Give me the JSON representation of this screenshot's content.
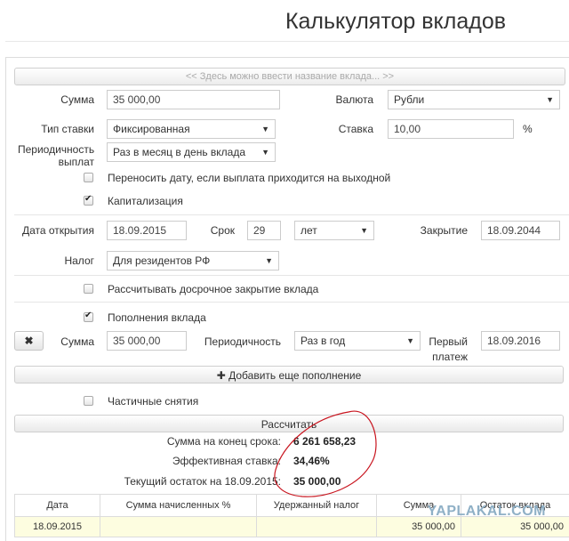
{
  "page_title": "Калькулятор вкладов",
  "deposit_name_placeholder": "<< Здесь можно ввести название вклада... >>",
  "form": {
    "amount_label": "Сумма",
    "amount_value": "35 000,00",
    "currency_label": "Валюта",
    "currency_value": "Рубли",
    "rate_type_label": "Тип ставки",
    "rate_type_value": "Фиксированная",
    "rate_label": "Ставка",
    "rate_value": "10,00",
    "rate_unit": "%",
    "payout_label_1": "Периодичность",
    "payout_label_2": "выплат",
    "payout_value": "Раз в месяц в день вклада",
    "move_date_label": "Переносить дату, если выплата приходится на выходной",
    "capitalization_label": "Капитализация",
    "open_date_label": "Дата открытия",
    "open_date_value": "18.09.2015",
    "term_label": "Срок",
    "term_value": "29",
    "term_unit_value": "лет",
    "close_label": "Закрытие",
    "close_value": "18.09.2044",
    "tax_label": "Налог",
    "tax_value": "Для резидентов РФ",
    "early_close_label": "Рассчитывать досрочное закрытие вклада",
    "topups_label": "Пополнения вклада",
    "topup": {
      "remove_icon": "✖",
      "amount_label": "Сумма",
      "amount_value": "35 000,00",
      "period_label": "Периодичность",
      "period_value": "Раз в год",
      "first_label_1": "Первый",
      "first_label_2": "платеж",
      "first_value": "18.09.2016"
    },
    "add_topup_label": "✚ Добавить еще пополнение",
    "partial_withdraw_label": "Частичные снятия",
    "calculate_label": "Рассчитать"
  },
  "results": {
    "total_label": "Сумма на конец срока:",
    "total_value": "6 261 658,23",
    "eff_rate_label": "Эффективная ставка:",
    "eff_rate_value": "34,46%",
    "balance_label": "Текущий остаток на 18.09.2015:",
    "balance_value": "35 000,00"
  },
  "table": {
    "headers": [
      "Дата",
      "Сумма начисленных %",
      "Удержанный налог",
      "Сумма",
      "Остаток вклада"
    ],
    "rows": [
      [
        "18.09.2015",
        "",
        "",
        "35 000,00",
        "35 000,00"
      ]
    ]
  },
  "watermark": "YAPLAKAL.COM",
  "colors": {
    "annotation": "#c8141e",
    "row_highlight": "#fdfde0"
  }
}
